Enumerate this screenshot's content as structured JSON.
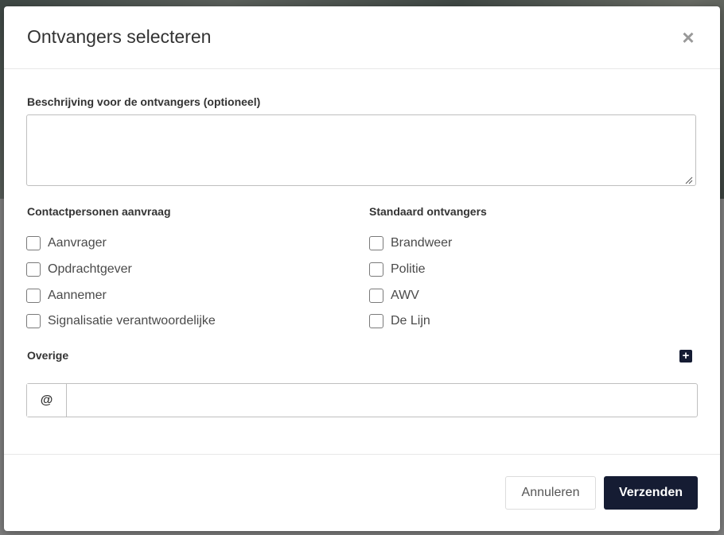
{
  "modal": {
    "title": "Ontvangers selecteren",
    "close_icon": "close-icon"
  },
  "description": {
    "label": "Beschrijving voor de ontvangers (optioneel)",
    "value": ""
  },
  "contact_persons": {
    "label": "Contactpersonen aanvraag",
    "items": [
      {
        "label": "Aanvrager",
        "checked": false
      },
      {
        "label": "Opdrachtgever",
        "checked": false
      },
      {
        "label": "Aannemer",
        "checked": false
      },
      {
        "label": "Signalisatie verantwoordelijke",
        "checked": false
      }
    ]
  },
  "standard_recipients": {
    "label": "Standaard ontvangers",
    "items": [
      {
        "label": "Brandweer",
        "checked": false
      },
      {
        "label": "Politie",
        "checked": false
      },
      {
        "label": "AWV",
        "checked": false
      },
      {
        "label": "De Lijn",
        "checked": false
      }
    ]
  },
  "other": {
    "label": "Overige",
    "add_icon": "plus-square-icon",
    "email_prefix": "@",
    "email_value": ""
  },
  "footer": {
    "cancel_label": "Annuleren",
    "send_label": "Verzenden"
  },
  "colors": {
    "primary": "#151c33",
    "border": "#bfbfbf"
  }
}
